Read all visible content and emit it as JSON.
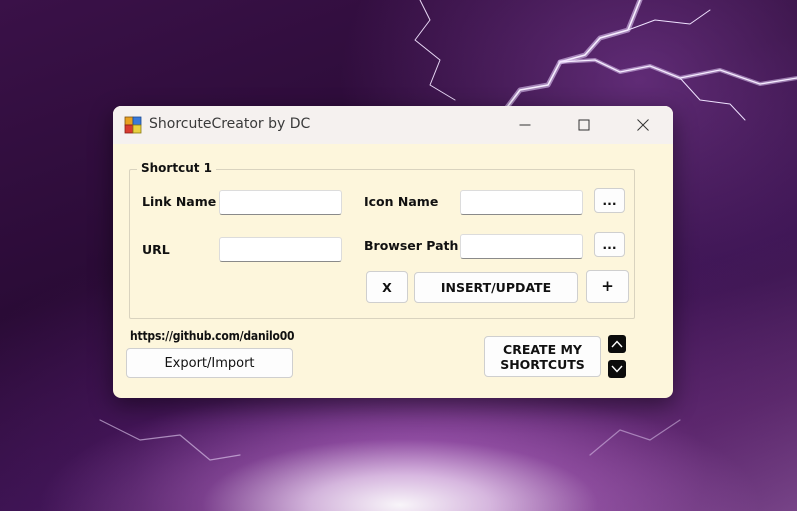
{
  "window": {
    "title": "ShorcuteCreator by DC"
  },
  "group": {
    "title": "Shortcut 1"
  },
  "fields": {
    "link_name_label": "Link Name",
    "link_name_value": "",
    "url_label": "URL",
    "url_value": "",
    "icon_name_label": "Icon Name",
    "icon_name_value": "",
    "browser_path_label": "Browser Path",
    "browser_path_value": ""
  },
  "buttons": {
    "browse_icon": "...",
    "browse_browser": "...",
    "remove": "X",
    "insert_update": "INSERT/UPDATE",
    "add": "+",
    "export_import": "Export/Import",
    "create_line1": "CREATE MY",
    "create_line2": "SHORTCUTS"
  },
  "footer": {
    "link": "https://github.com/danilo00"
  },
  "icons": {
    "app": "app-icon",
    "minimize": "minimize-icon",
    "maximize": "maximize-icon",
    "close": "close-icon",
    "up": "chevron-up-icon",
    "down": "chevron-down-icon"
  }
}
